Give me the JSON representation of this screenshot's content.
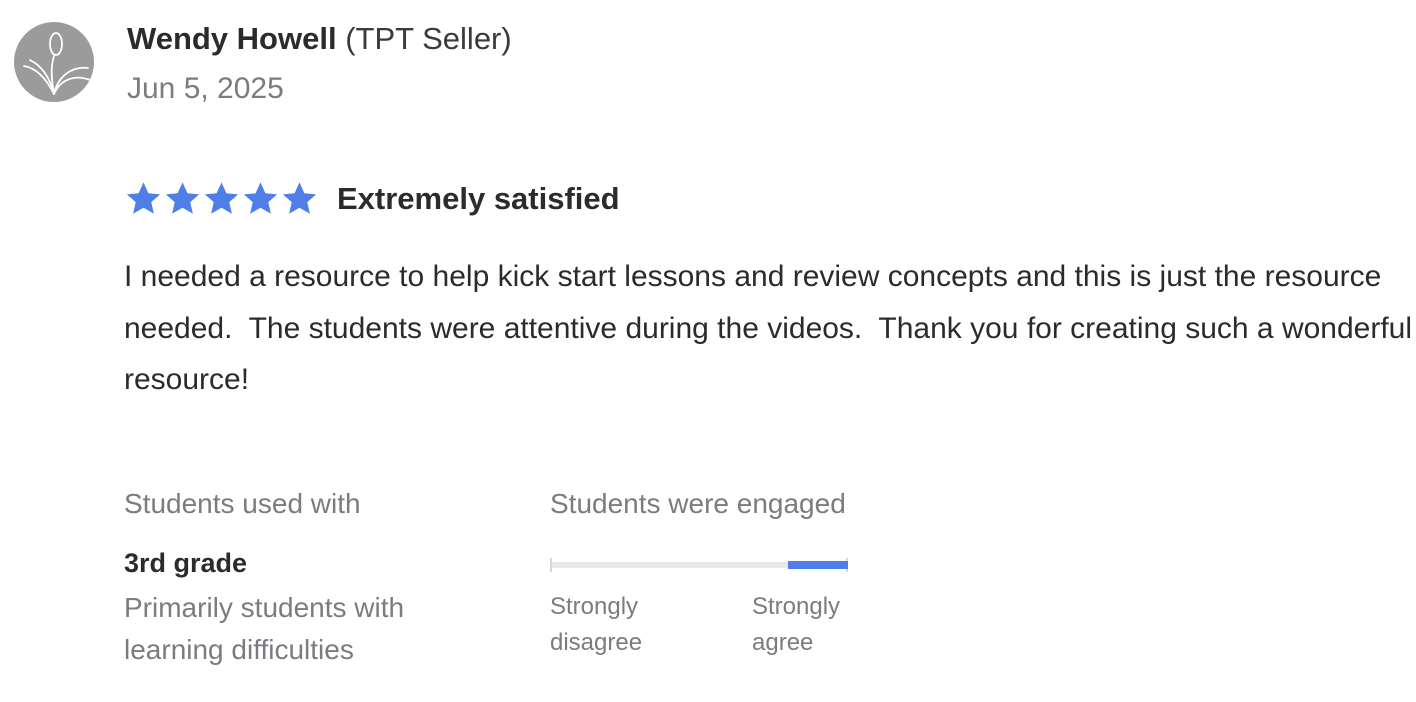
{
  "review": {
    "author_name": "Wendy Howell",
    "author_role": "(TPT Seller)",
    "date": "Jun 5, 2025",
    "rating": 5,
    "rating_max": 5,
    "rating_label": "Extremely satisfied",
    "body": "I needed a resource to help kick start lessons and review concepts and this is just the resource needed.  The students were attentive during the videos.  Thank you for creating such a wonderful resource!"
  },
  "students_used_with": {
    "heading": "Students used with",
    "grade": "3rd grade",
    "note": "Primarily students with learning difficulties"
  },
  "engagement": {
    "heading": "Students were engaged",
    "value_start": 0.8,
    "value_end": 1.0,
    "min_label": "Strongly disagree",
    "max_label": "Strongly agree"
  },
  "colors": {
    "star": "#4f7ee8",
    "scale_fill": "#4f7ee8",
    "avatar_bg": "#9b9b9b"
  },
  "icons": {
    "avatar": "leaf-logo-icon",
    "star": "star-icon"
  }
}
